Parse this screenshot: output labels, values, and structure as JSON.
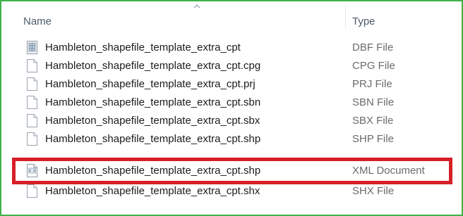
{
  "columns": {
    "name": "Name",
    "type": "Type"
  },
  "accent": {
    "frame_border": "#3fb24a",
    "highlight_border": "#d71f26"
  },
  "files": [
    {
      "name": "Hambleton_shapefile_template_extra_cpt",
      "type": "DBF File",
      "icon": "dbf-file-icon"
    },
    {
      "name": "Hambleton_shapefile_template_extra_cpt.cpg",
      "type": "CPG File",
      "icon": "generic-file-icon"
    },
    {
      "name": "Hambleton_shapefile_template_extra_cpt.prj",
      "type": "PRJ File",
      "icon": "generic-file-icon"
    },
    {
      "name": "Hambleton_shapefile_template_extra_cpt.sbn",
      "type": "SBN File",
      "icon": "generic-file-icon"
    },
    {
      "name": "Hambleton_shapefile_template_extra_cpt.sbx",
      "type": "SBX File",
      "icon": "generic-file-icon"
    },
    {
      "name": "Hambleton_shapefile_template_extra_cpt.shp",
      "type": "SHP File",
      "icon": "generic-file-icon"
    },
    {
      "name": "Hambleton_shapefile_template_extra_cpt.shp",
      "type": "XML Document",
      "icon": "xml-file-icon"
    },
    {
      "name": "Hambleton_shapefile_template_extra_cpt.shx",
      "type": "SHX File",
      "icon": "generic-file-icon"
    }
  ]
}
